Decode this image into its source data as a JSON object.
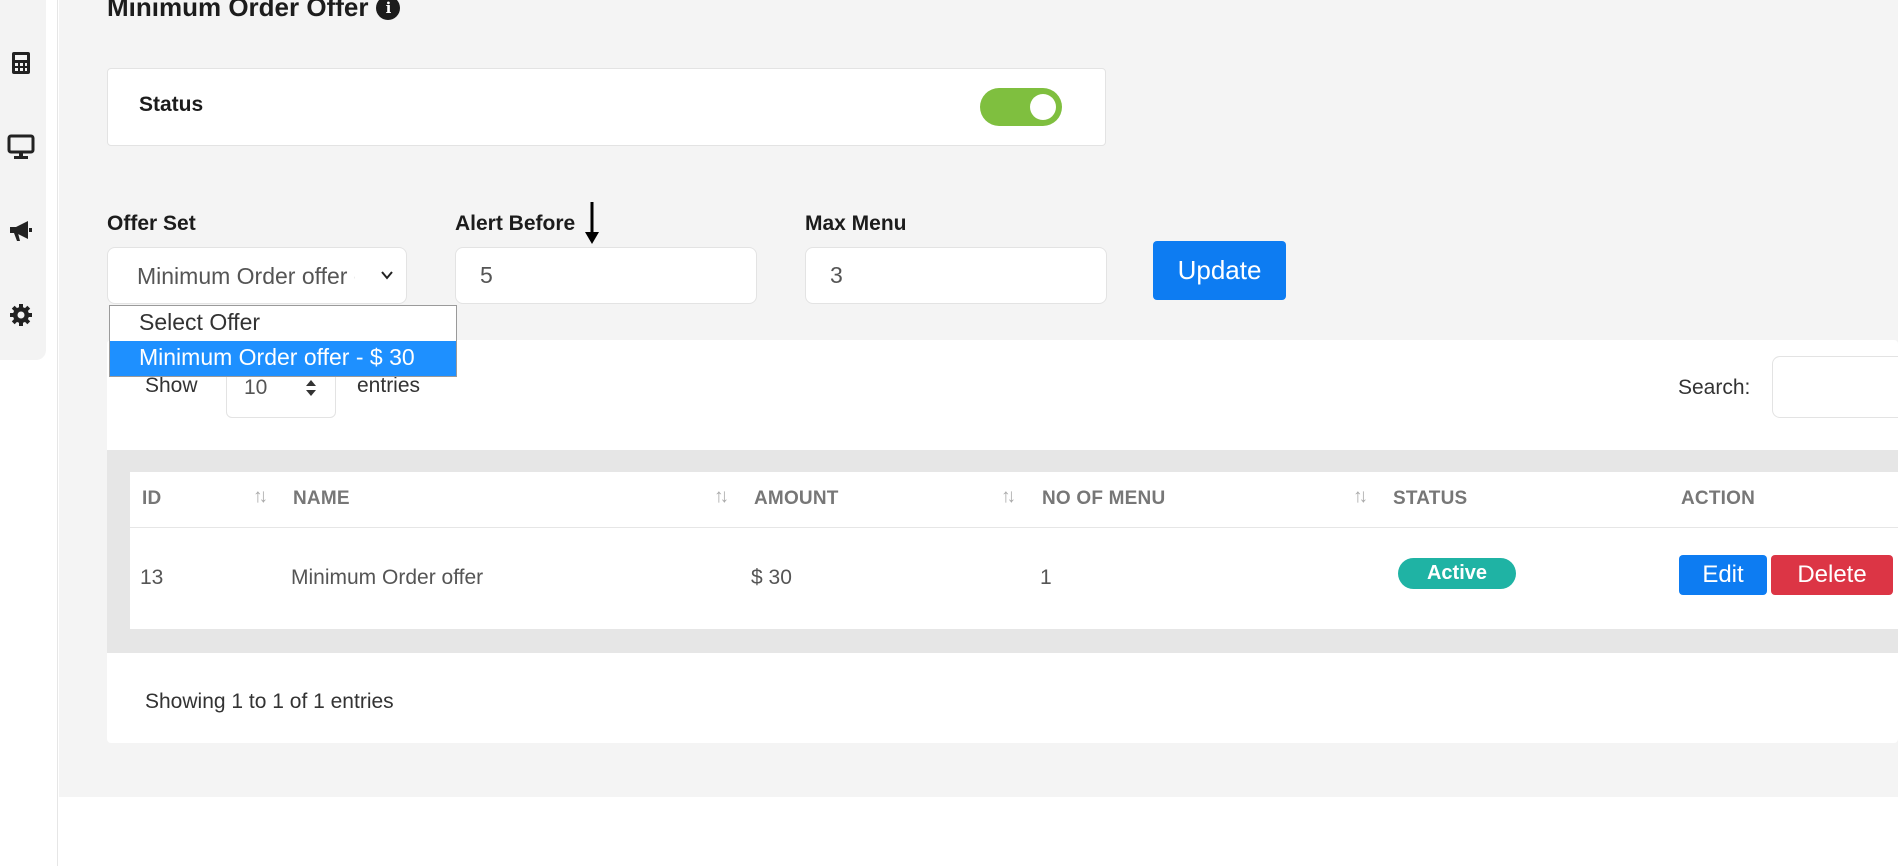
{
  "page": {
    "title": "Minimum Order Offer"
  },
  "status_card": {
    "label": "Status",
    "toggle_on": true,
    "toggle_color": "#7fbf3f"
  },
  "form": {
    "offer_set": {
      "label": "Offer Set",
      "value": "Minimum Order offer - $ 30",
      "options": [
        "Select Offer",
        "Minimum Order offer - $ 30"
      ],
      "selected_index": 1
    },
    "alert_before": {
      "label": "Alert Before",
      "value": "5"
    },
    "max_menu": {
      "label": "Max Menu",
      "value": "3"
    },
    "update_label": "Update"
  },
  "table_controls": {
    "show_label": "Show",
    "page_size": "10",
    "entries_label": "entries",
    "search_label": "Search:",
    "search_value": ""
  },
  "table": {
    "columns": [
      "ID",
      "NAME",
      "AMOUNT",
      "NO OF MENU",
      "STATUS",
      "ACTION"
    ],
    "rows": [
      {
        "id": "13",
        "name": "Minimum Order offer",
        "amount": "$ 30",
        "no_of_menu": "1",
        "status": "Active",
        "actions": [
          "Edit",
          "Delete"
        ]
      }
    ],
    "footer": "Showing 1 to 1 of 1 entries"
  },
  "colors": {
    "primary": "#0d7cf2",
    "danger": "#dc3545",
    "active_badge": "#1fb3a4",
    "dropdown_highlight": "#1e90ff"
  },
  "sidebar": {
    "icons": [
      "calculator-icon",
      "monitor-icon",
      "megaphone-icon",
      "gear-icon"
    ]
  }
}
